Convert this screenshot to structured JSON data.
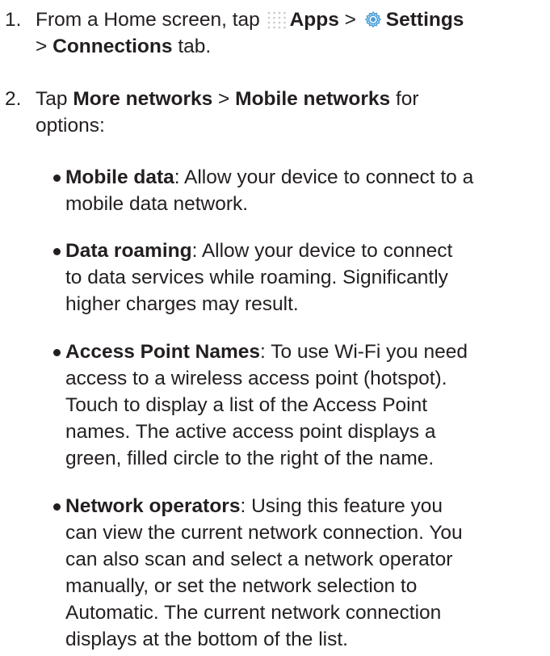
{
  "steps": [
    {
      "number": "1.",
      "home_text": "From a Home screen, tap",
      "apps_label": "Apps",
      "sep1": ">",
      "settings_label": "Settings",
      "sep2": ">",
      "connections_label": "Connections",
      "tab_text": "tab.",
      "apps_icon": "apps-grid-icon",
      "settings_icon": "settings-gear-icon"
    },
    {
      "number": "2.",
      "tap_text": "Tap",
      "more_networks": "More networks",
      "sep": ">",
      "mobile_networks": "Mobile networks",
      "for_text": "for",
      "options_text": "options:"
    }
  ],
  "bullets": [
    {
      "term": "Mobile data",
      "lines": [
        ": Allow your device to connect to a",
        "mobile data network."
      ]
    },
    {
      "term": "Data roaming",
      "lines": [
        ": Allow your device to connect",
        "to data services while roaming. Significantly",
        "higher charges may result."
      ]
    },
    {
      "term": "Access Point Names",
      "lines": [
        ": To use Wi-Fi you need",
        "access to a wireless access point (hotspot).",
        "Touch to display a list of the Access Point",
        "names. The active access point displays a",
        "green, filled circle to the right of the name."
      ]
    },
    {
      "term": "Network operators",
      "lines": [
        ": Using this feature you",
        "can view the current network connection. You",
        "can also scan and select a network operator",
        "manually, or set the network selection to",
        "Automatic. The current network connection",
        "displays at the bottom of the list."
      ]
    }
  ],
  "colors": {
    "text": "#231f20",
    "apps_icon": "#c8c8c8",
    "settings_icon_ring": "#4a9fd8"
  }
}
